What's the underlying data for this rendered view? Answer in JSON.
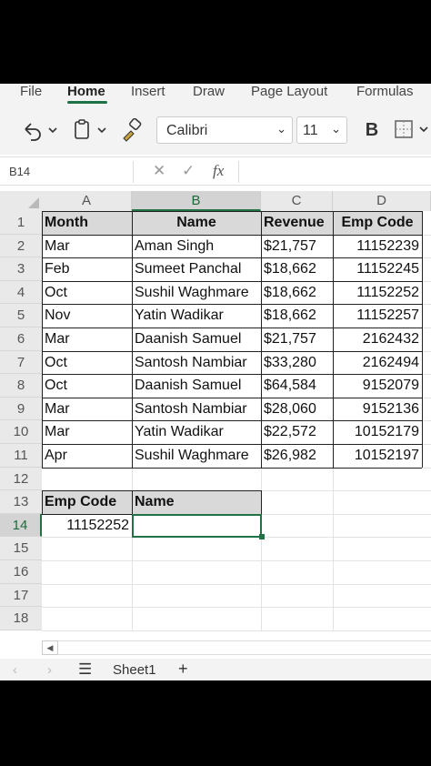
{
  "menu": [
    "File",
    "Home",
    "Insert",
    "Draw",
    "Page Layout",
    "Formulas"
  ],
  "ribbon": {
    "font": "Calibri",
    "size": "11",
    "bold": "B",
    "undo_icon": "undo-icon",
    "paste_icon": "clipboard-icon",
    "format_painter_icon": "brush-icon",
    "borders_icon": "borders-icon"
  },
  "formula_bar": {
    "name_box": "B14",
    "fx": "fx",
    "value": ""
  },
  "columns": [
    "A",
    "B",
    "C",
    "D"
  ],
  "rows": [
    "1",
    "2",
    "3",
    "4",
    "5",
    "6",
    "7",
    "8",
    "9",
    "10",
    "11",
    "12",
    "13",
    "14",
    "15",
    "16",
    "17",
    "18"
  ],
  "table": {
    "headers": [
      "Month",
      "Name",
      "Revenue",
      "Emp Code"
    ],
    "rows": [
      [
        "Mar",
        "Aman Singh",
        "$21,757",
        "11152239"
      ],
      [
        "Feb",
        "Sumeet Panchal",
        "$18,662",
        "11152245"
      ],
      [
        "Oct",
        "Sushil Waghmare",
        "$18,662",
        "11152252"
      ],
      [
        "Nov",
        "Yatin Wadikar",
        "$18,662",
        "11152257"
      ],
      [
        "Mar",
        "Daanish Samuel",
        "$21,757",
        "2162432"
      ],
      [
        "Oct",
        "Santosh Nambiar",
        "$33,280",
        "2162494"
      ],
      [
        "Oct",
        "Daanish Samuel",
        "$64,584",
        "9152079"
      ],
      [
        "Mar",
        "Santosh Nambiar",
        "$28,060",
        "9152136"
      ],
      [
        "Mar",
        "Yatin Wadikar",
        "$22,572",
        "10152179"
      ],
      [
        "Apr",
        "Sushil Waghmare",
        "$26,982",
        "10152197"
      ]
    ]
  },
  "lookup": {
    "headers": [
      "Emp Code",
      "Name"
    ],
    "emp_code": "11152252",
    "name": ""
  },
  "sheet_tabs": {
    "active": "Sheet1",
    "add": "+",
    "menu_icon": "hamburger-icon",
    "prev_icon": "chevron-left-icon",
    "next_icon": "chevron-right-icon"
  },
  "colors": {
    "accent": "#217346",
    "header_fill": "#d9d9d9"
  }
}
